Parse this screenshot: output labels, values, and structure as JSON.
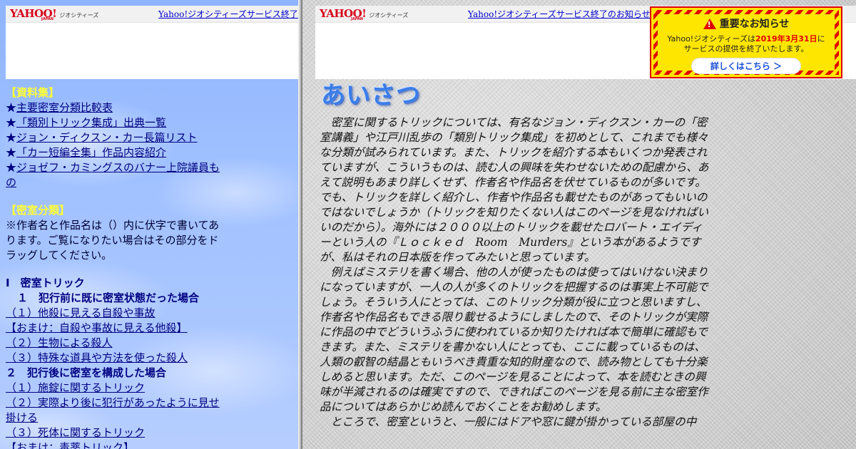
{
  "yahoo_bar": {
    "logo_text": "YAHOO!",
    "logo_sub": "JAPAN",
    "service_name": "ジオシティーズ",
    "left_notice_link": "Yahoo!ジオシティーズサービス終了の",
    "right_notice_link": "Yahoo!ジオシティーズサービス終了のお知らせ"
  },
  "alert": {
    "title": "重要なお知らせ",
    "line1_prefix": "Yahoo!ジオシティーズは",
    "line1_date": "2019年3月31日",
    "line1_suffix": "に",
    "line2": "サービスの提供を終了いたします。",
    "button_label": "詳しくはこちら ＞",
    "colors": {
      "background": "#ffe600",
      "stripe": "#e00000",
      "button_text": "#1a4fd8"
    }
  },
  "sidebar": {
    "materials_heading": "【資料集】",
    "materials": [
      "主要密室分類比較表",
      "「類別トリック集成」出典一覧",
      "ジョン・ディクスン・カー長篇リスト",
      "「カー短編全集」作品内容紹介",
      "ジョゼフ・カミングスのバナー上院議員もの"
    ],
    "star": "★",
    "classification_heading": "【密室分類】",
    "note": "※作者名と作品名は（）内に伏字で書いてあります。ご覧になりたい場合はその部分をドラッグしてください。",
    "section_1": "Ⅰ　密室トリック",
    "subsection_1": "１　犯行前に既に密室状態だった場合",
    "items_1": [
      "（１）他殺に見える自殺や事故",
      "【おまけ：自殺や事故に見える他殺】",
      "（２）生物による殺人",
      "（３）特殊な道具や方法を使った殺人"
    ],
    "subsection_2": "２　犯行後に密室を構成した場合",
    "items_2": [
      "（１）施錠に関するトリック",
      "（２）実際より後に犯行があったように見せ掛ける",
      "（３）死体に関するトリック",
      "【おまけ：毒薬トリック】"
    ]
  },
  "main": {
    "title": "あいさつ",
    "paragraphs": [
      "密室に関するトリックについては、有名なジョン・ディクスン・カーの「密室講義」や江戸川乱歩の「類別トリック集成」を初めとして、これまでも様々な分類が試みられています。また、トリックを紹介する本もいくつか発表されていますが、こういうものは、読む人の興味を失わせないための配慮から、あえて説明もあまり詳しくせず、作者名や作品名を伏せているものが多いです。でも、トリックを詳しく紹介し、作者や作品名も載せたものがあってもいいのではないでしょうか（トリックを知りたくない人はこのページを見なければいいのだから）。海外には２０００以上のトリックを載せたロバート・エイディーという人の『Ｌｏｃｋｅｄ　Room　Murders』という本があるようですが、私はそれの日本版を作ってみたいと思っています。",
      "例えばミステリを書く場合、他の人が使ったものは使ってはいけない決まりになっていますが、一人の人が多くのトリックを把握するのは事実上不可能でしょう。そういう人にとっては、このトリック分類が役に立つと思いますし、作者名や作品名もできる限り載せるようにしましたので、そのトリックが実際に作品の中でどういうふうに使われているか知りたければ本で簡単に確認もできます。また、ミステリを書かない人にとっても、ここに載っているものは、人類の叡智の結晶ともいうべき貴重な知的財産なので、読み物としても十分楽しめると思います。ただ、このページを見ることによって、本を読むときの興味が半減されるのは確実ですので、できればこのページを見る前に主な密室作品についてはあらかじめ読んでおくことをお勧めします。",
      "ところで、密室というと、一般にはドアや窓に鍵が掛かっている部屋の中"
    ]
  }
}
